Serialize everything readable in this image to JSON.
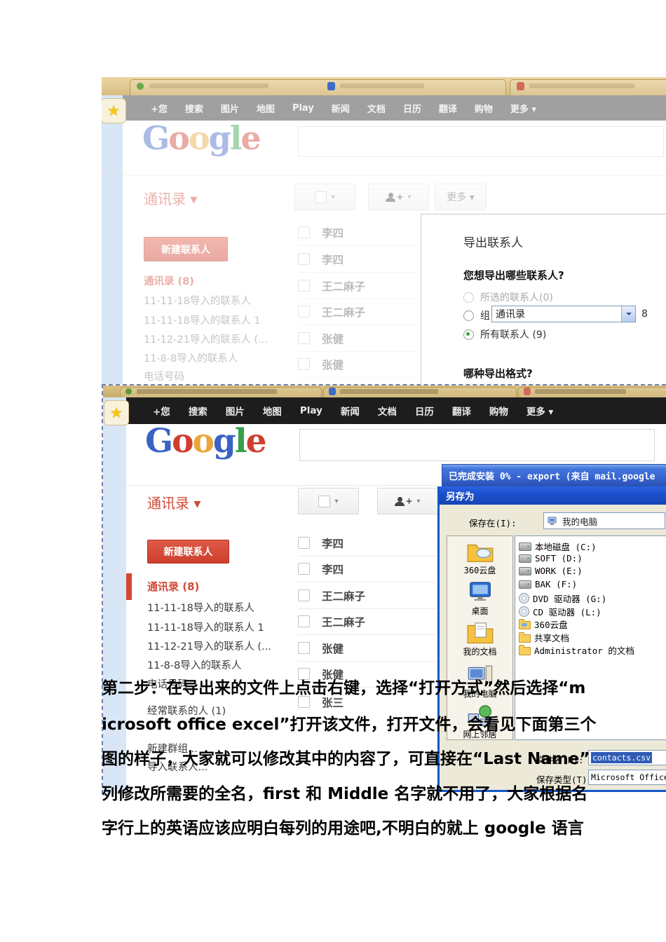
{
  "ui": {
    "caret": "▾",
    "star": "★",
    "plus": "+"
  },
  "nav": {
    "items": [
      "+您",
      "搜索",
      "图片",
      "地图",
      "Play",
      "新闻",
      "文档",
      "日历",
      "翻译",
      "购物",
      "更多 ▾"
    ]
  },
  "logo": {
    "letters": [
      "G",
      "o",
      "o",
      "g",
      "l",
      "e"
    ]
  },
  "shot1": {
    "contacts_dropdown": "通讯录 ▾",
    "more_button": "更多 ▾",
    "new_contact_button": "新建联系人",
    "sidebar": [
      "通讯录 (8)",
      "11-11-18导入的联系人",
      "11-11-18导入的联系人 1",
      "11-12-21导入的联系人 (...",
      "11-8-8导入的联系人",
      "电话号码"
    ],
    "contacts": [
      "李四",
      "李四",
      "王二麻子",
      "王二麻子",
      "张健",
      "张健"
    ],
    "export_dialog": {
      "title": "导出联系人",
      "question1": "您想导出哪些联系人?",
      "option_selected": "所选的联系人(0)",
      "option_group_label": "组",
      "group_value": "通讯录",
      "group_count": "8",
      "option_all": "所有联系人 (9)",
      "question2": "哪种导出格式?"
    }
  },
  "shot2": {
    "contacts_dropdown": "通讯录 ▾",
    "new_contact_button": "新建联系人",
    "sidebar": [
      "通讯录 (8)",
      "11-11-18导入的联系人",
      "11-11-18导入的联系人 1",
      "11-12-21导入的联系人 (...",
      "11-8-8导入的联系人",
      "电话号码",
      "经常联系的人 (1)",
      "新建群组...",
      "导入联系人..."
    ],
    "contacts": [
      "李四",
      "李四",
      "王二麻子",
      "王二麻子",
      "张健",
      "张健",
      "张三"
    ],
    "download_window_title": "已完成安装 0% - export (来自 mail.google",
    "save_dialog": {
      "title": "另存为",
      "save_in_label": "保存在(I):",
      "save_in_value": "我的电脑",
      "places": [
        "360云盘",
        "桌面",
        "我的文档",
        "我的电脑",
        "网上邻居"
      ],
      "files": [
        {
          "label": "本地磁盘 (C:)",
          "icon": "hard-disk"
        },
        {
          "label": "SOFT (D:)",
          "icon": "hard-disk"
        },
        {
          "label": "WORK (E:)",
          "icon": "hard-disk"
        },
        {
          "label": "BAK (F:)",
          "icon": "hard-disk"
        },
        {
          "label": "DVD 驱动器 (G:)",
          "icon": "optical-drive"
        },
        {
          "label": "CD 驱动器 (L:)",
          "icon": "optical-drive"
        },
        {
          "label": "360云盘",
          "icon": "cloud-folder"
        },
        {
          "label": "共享文档",
          "icon": "folder"
        },
        {
          "label": "Administrator 的文档",
          "icon": "folder"
        }
      ],
      "filename_label": "文件名(N):",
      "filename_value": "contacts.csv",
      "filetype_label": "保存类型(T):",
      "filetype_value": "Microsoft Office E"
    }
  },
  "body_text": {
    "lines": [
      "第二步：在导出来的文件上点击右键，选择“打开方式”然后选择“m",
      "icrosoft office excel”打开该文件，打开文件，会看见下面第三个",
      "图的样子，大家就可以修改其中的内容了，可直接在“Last Name”",
      "列修改所需要的全名，first 和 Middle 名字就不用了，大家根据名",
      "字行上的英语应该应明白每列的用途吧,不明白的就上 google 语言"
    ]
  }
}
